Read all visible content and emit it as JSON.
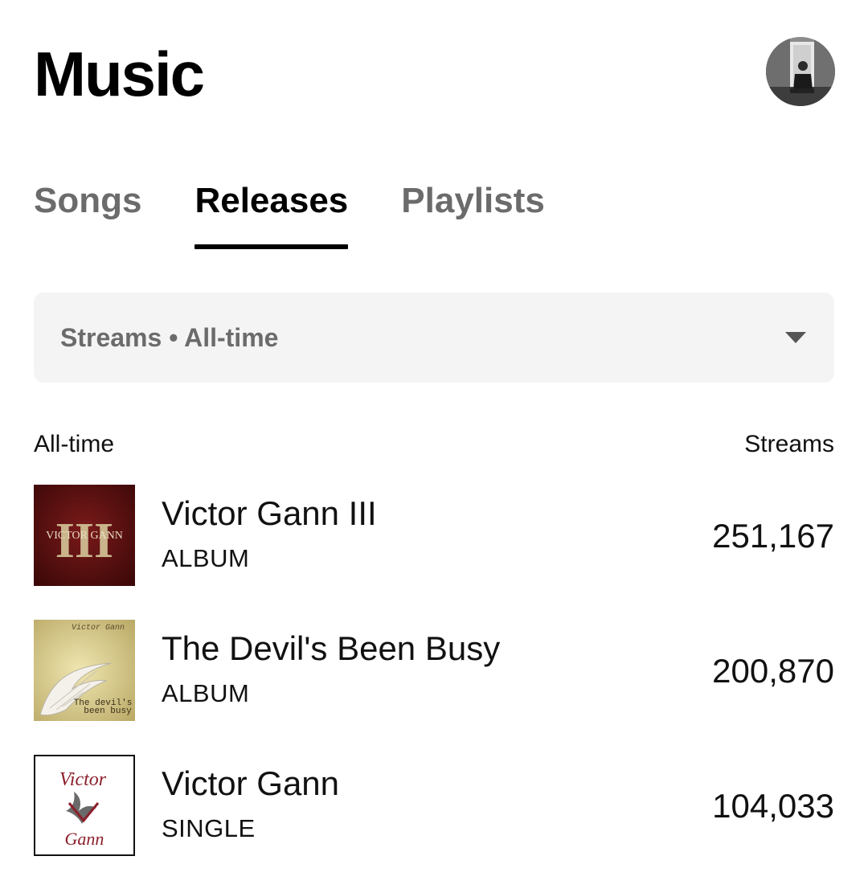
{
  "header": {
    "title": "Music",
    "avatar_icon": "user-avatar-photo"
  },
  "tabs": [
    {
      "label": "Songs",
      "active": false
    },
    {
      "label": "Releases",
      "active": true
    },
    {
      "label": "Playlists",
      "active": false
    }
  ],
  "filter": {
    "label": "Streams • All-time",
    "icon": "chevron-down-icon"
  },
  "list": {
    "left_header": "All-time",
    "right_header": "Streams",
    "items": [
      {
        "title": "Victor Gann III",
        "type": "ALBUM",
        "streams": "251,167",
        "cover_text": "VICTOR GANN",
        "cover_numeral": "III"
      },
      {
        "title": "The Devil's Been Busy",
        "type": "ALBUM",
        "streams": "200,870",
        "cover_text_top": "Victor Gann",
        "cover_text_bottom_1": "The devil's",
        "cover_text_bottom_2": "been busy"
      },
      {
        "title": "Victor Gann",
        "type": "SINGLE",
        "streams": "104,033",
        "cover_text_top": "Victor",
        "cover_text_bottom": "Gann"
      }
    ]
  }
}
